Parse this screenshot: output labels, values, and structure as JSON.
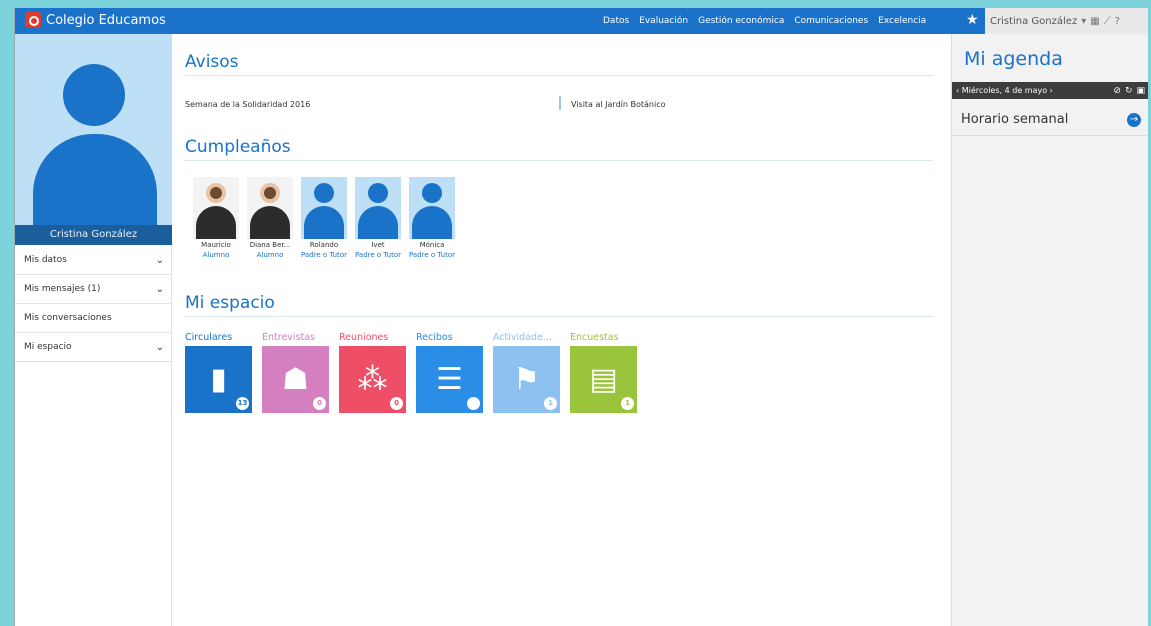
{
  "header": {
    "brand": "Colegio Educamos",
    "nav": [
      "Datos",
      "Evaluación",
      "Gestión económica",
      "Comunicaciones",
      "Excelencia"
    ],
    "user_name": "Cristina González",
    "icons": [
      "star-icon",
      "chevron-down-icon",
      "calendar-grid-icon",
      "chart-icon",
      "help-icon"
    ]
  },
  "sidebar": {
    "profile_name": "Cristina González",
    "items": [
      {
        "label": "Mis datos",
        "expandable": true
      },
      {
        "label": "Mis mensajes (1)",
        "expandable": true
      },
      {
        "label": "Mis conversaciones",
        "expandable": false
      },
      {
        "label": "Mi espacio",
        "expandable": true
      }
    ]
  },
  "avisos": {
    "title": "Avisos",
    "items": [
      "Semana de la Solidaridad 2016",
      "Visita al Jardín Botánico"
    ]
  },
  "cumpleanos": {
    "title": "Cumpleaños",
    "people": [
      {
        "name": "Mauricio",
        "role": "Alumno",
        "photo": true
      },
      {
        "name": "Diana Ber...",
        "role": "Alumno",
        "photo": true
      },
      {
        "name": "Rolando",
        "role": "Padre o Tutor",
        "photo": false
      },
      {
        "name": "Ivet",
        "role": "Padre o Tutor",
        "photo": false
      },
      {
        "name": "Mónica",
        "role": "Padre o Tutor",
        "photo": false
      }
    ]
  },
  "mi_espacio": {
    "title": "Mi espacio",
    "tiles": [
      {
        "label": "Circulares",
        "count": "13",
        "color": "#1a73c9",
        "icon": "document-icon"
      },
      {
        "label": "Entrevistas",
        "count": "0",
        "color": "#d37fc0",
        "icon": "people-icon"
      },
      {
        "label": "Reuniones",
        "count": "0",
        "color": "#ef4f66",
        "icon": "meeting-icon"
      },
      {
        "label": "Recibos",
        "count": "",
        "color": "#2b8ee6",
        "icon": "receipt-icon"
      },
      {
        "label": "Actividade...",
        "count": "1",
        "color": "#8cc1f0",
        "icon": "activity-icon"
      },
      {
        "label": "Encuestas",
        "count": "1",
        "color": "#9bc43d",
        "icon": "clipboard-icon"
      }
    ]
  },
  "agenda": {
    "title": "Mi agenda",
    "date": "Miércoles, 4 de mayo",
    "horario": "Horario semanal"
  }
}
